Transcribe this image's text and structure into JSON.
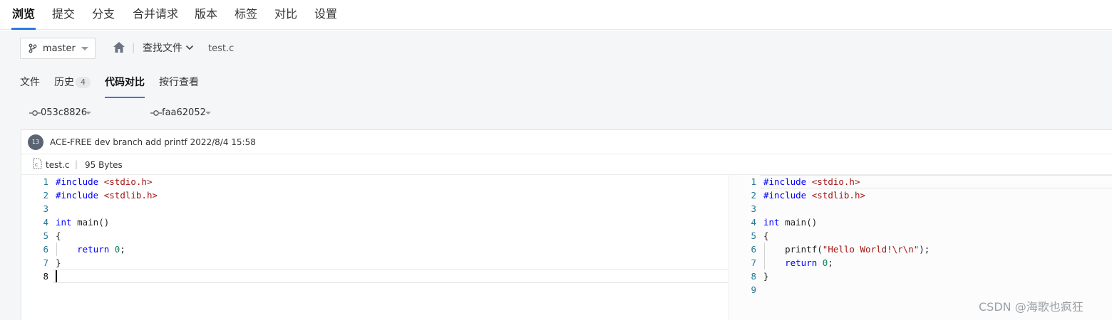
{
  "top_tabs": [
    "浏览",
    "提交",
    "分支",
    "合并请求",
    "版本",
    "标签",
    "对比",
    "设置"
  ],
  "branch": {
    "label": "master"
  },
  "breadcrumb": {
    "find_file": "查找文件",
    "file": "test.c"
  },
  "sub_tabs": {
    "files": "文件",
    "history": "历史",
    "history_count": "4",
    "code_compare": "代码对比",
    "blame": "按行查看"
  },
  "compare": {
    "left_commit": "053c8826",
    "right_commit": "faa62052"
  },
  "commit": {
    "avatar_text": "13",
    "message": "ACE-FREE dev branch add printf 2022/8/4 15:58"
  },
  "file_info": {
    "name": "test.c",
    "separator": "|",
    "size": "95 Bytes"
  },
  "left_code": {
    "line_numbers": [
      "1",
      "2",
      "3",
      "4",
      "5",
      "6",
      "7",
      "8"
    ],
    "l1_kw": "#include",
    "l1_hdr": " <stdio.h>",
    "l2_kw": "#include",
    "l2_hdr": " <stdlib.h>",
    "l4_kw": "int",
    "l4_rest": " main()",
    "l5": "{",
    "l6_kw": "    return",
    "l6_sp": " ",
    "l6_num": "0",
    "l6_end": ";",
    "l7": "}"
  },
  "right_code": {
    "line_numbers": [
      "1",
      "2",
      "3",
      "4",
      "5",
      "6",
      "7",
      "8",
      "9"
    ],
    "l1_kw": "#include",
    "l1_hdr": " <stdio.h>",
    "l2_kw": "#include",
    "l2_hdr": " <stdlib.h>",
    "l4_kw": "int",
    "l4_rest": " main()",
    "l5": "{",
    "l6_pre": "    printf(",
    "l6_str": "\"Hello World!\\r\\n\"",
    "l6_end": ");",
    "l7_kw": "    return",
    "l7_sp": " ",
    "l7_num": "0",
    "l7_end": ";",
    "l8": "}"
  },
  "watermark": "CSDN @海歌也疯狂",
  "colors": {
    "accent": "#2c7be5",
    "keyword": "#0000ff",
    "string": "#a31515",
    "number": "#098658",
    "line_number": "#237893"
  },
  "icons": [
    "branch-icon",
    "home-icon",
    "chevron-down-icon",
    "commit-icon",
    "c-file-icon"
  ]
}
